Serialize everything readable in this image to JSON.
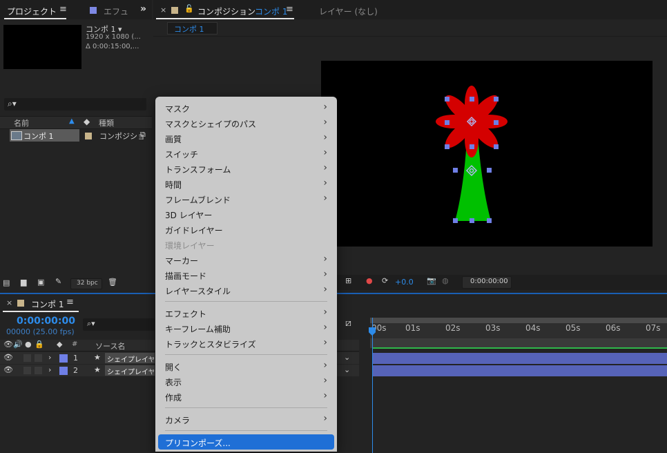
{
  "project": {
    "tab": "プロジェクト",
    "effects_tab": "エフュ",
    "comp_name": "コンポ 1 ▾",
    "comp_size": "1920 x 1080 (...",
    "comp_duration": "Δ 0:00:15:00,...",
    "columns": {
      "name": "名前",
      "type": "種類"
    },
    "items": [
      {
        "name": "コンポ 1",
        "type": "コンポジショ"
      }
    ],
    "bpc": "32 bpc"
  },
  "composition": {
    "title": "コンポジション",
    "comp_link": "コンポ 1",
    "layer_tab": "レイヤー (なし)",
    "sub_tab": "コンポ 1",
    "exposure": "+0.0",
    "timecode": "0:00:00:00"
  },
  "timeline": {
    "tab": "コンポ 1",
    "timecode": "0:00:00:00",
    "fps": "00000 (25.00 fps)",
    "col_number": "#",
    "col_source": "ソース名",
    "layers": [
      {
        "num": "1",
        "name": "シェイプレイヤー"
      },
      {
        "num": "2",
        "name": "シェイプレイヤー"
      }
    ],
    "ruler": [
      "00s",
      "01s",
      "02s",
      "03s",
      "04s",
      "05s",
      "06s",
      "07s"
    ]
  },
  "menu": {
    "items": [
      {
        "label": "マスク",
        "submenu": true
      },
      {
        "label": "マスクとシェイプのパス",
        "submenu": true
      },
      {
        "label": "画質",
        "submenu": true
      },
      {
        "label": "スイッチ",
        "submenu": true
      },
      {
        "label": "トランスフォーム",
        "submenu": true
      },
      {
        "label": "時間",
        "submenu": true
      },
      {
        "label": "フレームブレンド",
        "submenu": true
      },
      {
        "label": "3D レイヤー",
        "submenu": false
      },
      {
        "label": "ガイドレイヤー",
        "submenu": false
      },
      {
        "label": "環境レイヤー",
        "submenu": false,
        "disabled": true
      },
      {
        "label": "マーカー",
        "submenu": true
      },
      {
        "label": "描画モード",
        "submenu": true
      },
      {
        "label": "レイヤースタイル",
        "submenu": true
      },
      {
        "label": "エフェクト",
        "submenu": true
      },
      {
        "label": "キーフレーム補助",
        "submenu": true
      },
      {
        "label": "トラックとスタビライズ",
        "submenu": true
      },
      {
        "label": "開く",
        "submenu": true
      },
      {
        "label": "表示",
        "submenu": true
      },
      {
        "label": "作成",
        "submenu": true
      },
      {
        "label": "カメラ",
        "submenu": true
      },
      {
        "label": "プリコンポーズ...",
        "submenu": false,
        "highlighted": true
      }
    ]
  },
  "colors": {
    "accent": "#2d8ceb",
    "menu_highlight": "#1f6fd6",
    "petal": "#d40000",
    "stem": "#00c000",
    "handle": "#6f7fe6",
    "label_tan": "#c8b48a",
    "track": "#5663b8"
  }
}
